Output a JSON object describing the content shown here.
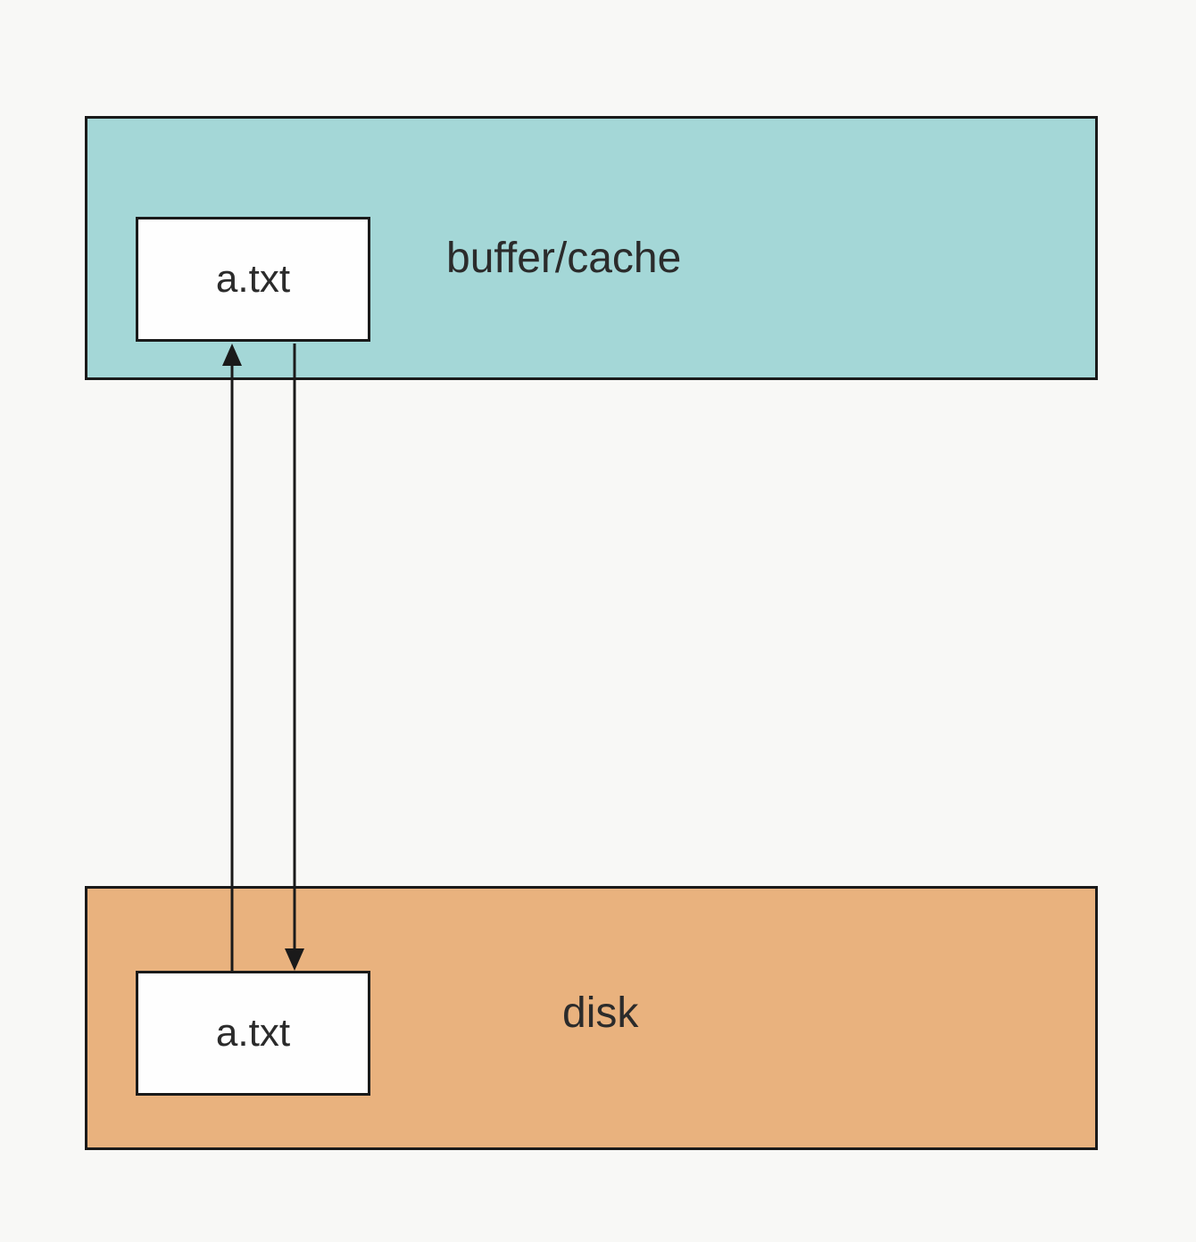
{
  "diagram": {
    "top_region_label": "buffer/cache",
    "bottom_region_label": "disk",
    "top_file_label": "a.txt",
    "bottom_file_label": "a.txt",
    "colors": {
      "top_region": "#a4d7d7",
      "bottom_region": "#e9b27e",
      "file_box": "#fefefe",
      "border": "#1a1a1a",
      "background": "#f8f8f6"
    },
    "arrows": [
      {
        "from": "disk-file",
        "to": "cache-file",
        "direction": "up"
      },
      {
        "from": "cache-file",
        "to": "disk-file",
        "direction": "down"
      }
    ]
  }
}
